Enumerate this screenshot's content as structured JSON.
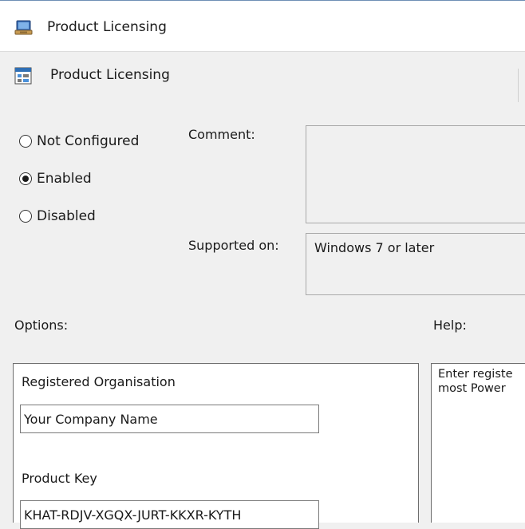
{
  "window": {
    "title": "Product Licensing"
  },
  "policy": {
    "name": "Product Licensing"
  },
  "state": {
    "options": [
      {
        "label": "Not Configured",
        "selected": false
      },
      {
        "label": "Enabled",
        "selected": true
      },
      {
        "label": "Disabled",
        "selected": false
      }
    ]
  },
  "comment": {
    "label": "Comment:",
    "value": ""
  },
  "supported": {
    "label": "Supported on:",
    "value": "Windows 7 or later"
  },
  "options_section": {
    "label": "Options:",
    "org_label": "Registered Organisation",
    "org_value": "Your Company Name",
    "key_label": "Product Key",
    "key_value": "KHAT-RDJV-XGQX-JURT-KKXR-KYTH"
  },
  "help_section": {
    "label": "Help:",
    "text_line1": "Enter registe",
    "text_line2": "most Power"
  }
}
